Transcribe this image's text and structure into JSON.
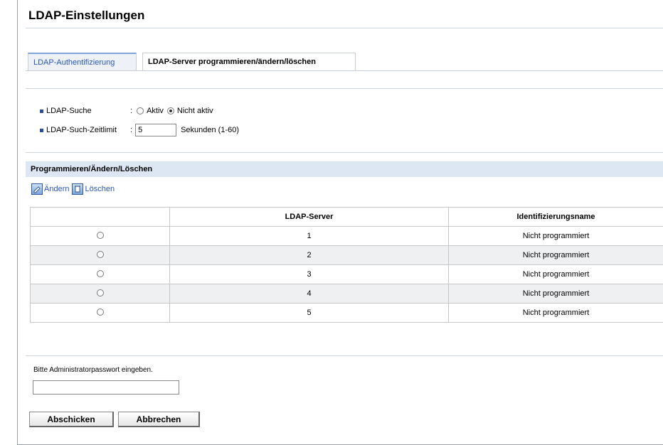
{
  "page": {
    "title": "LDAP-Einstellungen"
  },
  "tabs": [
    {
      "label": "LDAP-Authentifizierung",
      "active": false
    },
    {
      "label": "LDAP-Server programmieren/ändern/löschen",
      "active": true
    }
  ],
  "settings": {
    "search_label": "LDAP-Suche",
    "search_options": [
      {
        "label": "Aktiv",
        "selected": false
      },
      {
        "label": "Nicht aktiv",
        "selected": true
      }
    ],
    "timeout_label": "LDAP-Such-Zeitlimit",
    "timeout_value": "5",
    "timeout_unit": "Sekunden (1-60)",
    "separator": ":"
  },
  "section": {
    "title": "Programmieren/Ändern/Löschen",
    "change_label": "Ändern",
    "delete_label": "Löschen"
  },
  "table": {
    "headers": [
      "",
      "LDAP-Server",
      "Identifizierungsname"
    ],
    "rows": [
      {
        "server": "1",
        "name": "Nicht programmiert"
      },
      {
        "server": "2",
        "name": "Nicht programmiert"
      },
      {
        "server": "3",
        "name": "Nicht programmiert"
      },
      {
        "server": "4",
        "name": "Nicht programmiert"
      },
      {
        "server": "5",
        "name": "Nicht programmiert"
      }
    ]
  },
  "password": {
    "label": "Bitte Administratorpasswort eingeben.",
    "value": ""
  },
  "buttons": {
    "submit": "Abschicken",
    "cancel": "Abbrechen"
  },
  "colors": {
    "accent": "#2a56b8",
    "section_bg": "#dde7f3",
    "tab_inactive_bg": "#eef2f7"
  }
}
